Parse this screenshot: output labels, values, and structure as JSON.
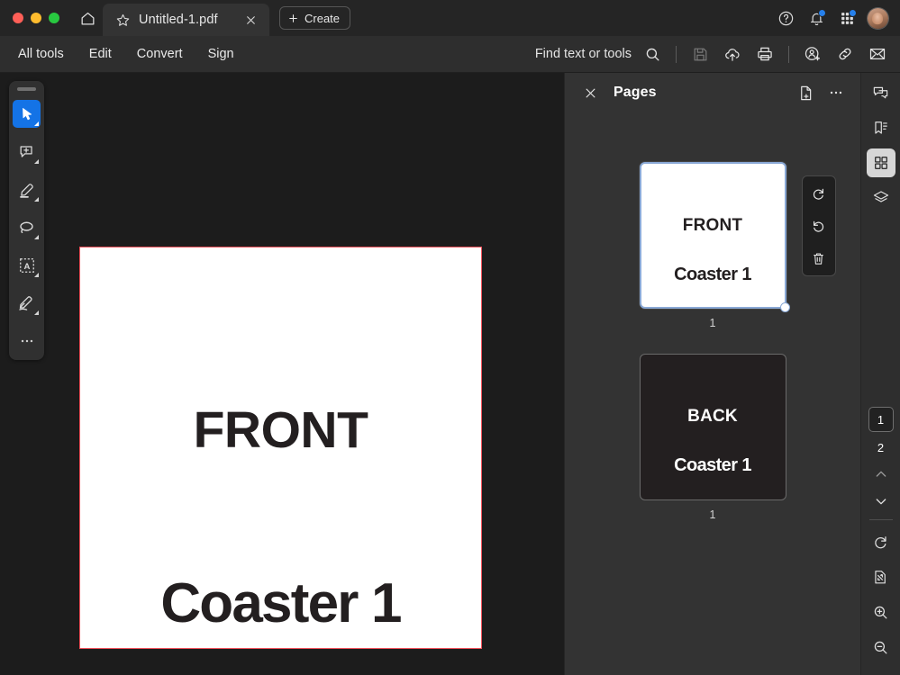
{
  "window": {
    "traffic_lights": [
      {
        "name": "close",
        "color": "#ff5f57"
      },
      {
        "name": "minimize",
        "color": "#febc2e"
      },
      {
        "name": "maximize",
        "color": "#28c840"
      }
    ],
    "home_icon": "home-icon"
  },
  "tab": {
    "star_icon": "star-icon",
    "title": "Untitled-1.pdf",
    "close_icon": "close-icon"
  },
  "create_button": {
    "label": "Create",
    "plus_icon": "plus-icon"
  },
  "titlebar_right": [
    {
      "name": "help-icon",
      "label": "Help",
      "badge": false
    },
    {
      "name": "notifications-bell-icon",
      "label": "Notifications",
      "badge": true
    },
    {
      "name": "app-switcher-grid-icon",
      "label": "Apps",
      "badge": true
    },
    {
      "name": "avatar",
      "label": "Account",
      "badge": false
    }
  ],
  "menubar": {
    "items": [
      {
        "label": "All tools"
      },
      {
        "label": "Edit"
      },
      {
        "label": "Convert"
      },
      {
        "label": "Sign"
      }
    ],
    "find_label": "Find text or tools",
    "search_icon": "search-icon",
    "right_icons": [
      {
        "name": "save-icon",
        "label": "Save",
        "disabled": true
      },
      {
        "name": "cloud-upload-icon",
        "label": "Save to cloud",
        "disabled": false
      },
      {
        "name": "print-icon",
        "label": "Print",
        "disabled": false
      },
      {
        "name": "add-person-icon",
        "label": "Invite people",
        "disabled": false
      },
      {
        "name": "link-icon",
        "label": "Copy link",
        "disabled": false
      },
      {
        "name": "email-icon",
        "label": "Email",
        "disabled": false
      }
    ]
  },
  "tools": [
    {
      "name": "select-tool",
      "label": "Select",
      "active": true
    },
    {
      "name": "comment-tool",
      "label": "Add comment",
      "active": false
    },
    {
      "name": "highlight-tool",
      "label": "Highlight",
      "active": false
    },
    {
      "name": "lasso-tool",
      "label": "Lasso select",
      "active": false
    },
    {
      "name": "text-select-tool",
      "label": "Select text",
      "active": false
    },
    {
      "name": "sign-tool",
      "label": "Fill and sign",
      "active": false
    },
    {
      "name": "more-tools",
      "label": "More tools",
      "active": false
    }
  ],
  "document": {
    "top_text": "FRONT",
    "bottom_text": "Coaster 1",
    "border_color": "#f2505a",
    "page_color": "#ffffff",
    "text_color": "#231f20"
  },
  "pages_panel": {
    "close_icon": "close-icon",
    "title": "Pages",
    "add_page_icon": "add-page-icon",
    "more_icon": "more-options-icon",
    "thumbnails": [
      {
        "top_text": "FRONT",
        "bottom_text": "Coaster 1",
        "number": "1",
        "theme": "light",
        "selected": true
      },
      {
        "top_text": "BACK",
        "bottom_text": "Coaster 1",
        "number": "1",
        "theme": "dark",
        "selected": false
      }
    ],
    "thumb_actions": [
      {
        "name": "rotate-clockwise-icon",
        "label": "Rotate clockwise"
      },
      {
        "name": "rotate-counterclockwise-icon",
        "label": "Rotate counterclockwise"
      },
      {
        "name": "delete-page-icon",
        "label": "Delete page"
      }
    ]
  },
  "right_rail": {
    "top_icons": [
      {
        "name": "comments-icon",
        "label": "Comments",
        "active": false
      },
      {
        "name": "bookmarks-icon",
        "label": "Bookmarks",
        "active": false
      },
      {
        "name": "page-thumbnails-icon",
        "label": "Page thumbnails",
        "active": true
      },
      {
        "name": "layers-icon",
        "label": "Layers",
        "active": false
      }
    ],
    "current_page": "1",
    "next_page": "2",
    "prev_icon": "chevron-up-icon",
    "next_icon": "chevron-down-icon",
    "bottom_icons": [
      {
        "name": "rotate-view-icon",
        "label": "Rotate view"
      },
      {
        "name": "fit-page-icon",
        "label": "Fit page"
      },
      {
        "name": "zoom-in-icon",
        "label": "Zoom in"
      },
      {
        "name": "zoom-out-icon",
        "label": "Zoom out"
      }
    ]
  },
  "colors": {
    "titlebar_bg": "#252525",
    "menubar_bg": "#2e2e2e",
    "canvas_bg": "#1c1c1c",
    "panel_bg": "#333333",
    "accent_blue": "#1473e6",
    "badge_blue": "#2680eb",
    "selection_border": "#8aa9d6"
  }
}
